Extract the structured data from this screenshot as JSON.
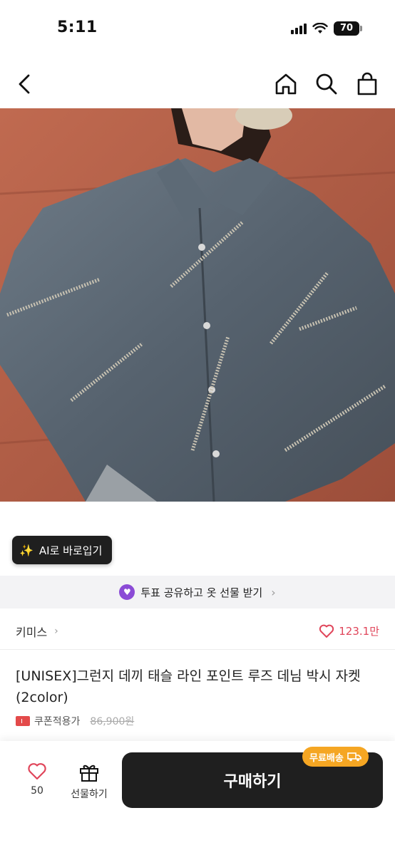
{
  "status": {
    "time": "5:11",
    "battery": "70"
  },
  "nav": {
    "back": "back",
    "home": "home",
    "search": "search",
    "bag": "shopping-bag"
  },
  "ai_button": {
    "label": "AI로 바로입기"
  },
  "share_banner": {
    "label": "투표 공유하고 옷 선물 받기"
  },
  "brand": {
    "name": "키미스",
    "likes": "123.1만"
  },
  "product": {
    "title": "[UNISEX]그런지 데끼 태슬 라인 포인트 루즈 데님 박시 자켓 (2color)",
    "coupon_label": "쿠폰적용가",
    "original_price": "86,900원"
  },
  "bottom": {
    "like_count": "50",
    "gift_label": "선물하기",
    "buy_label": "구매하기",
    "free_shipping": "무료배송"
  },
  "colors": {
    "accent_like": "#e0455a",
    "buy_button": "#1f1f1f",
    "free_ship": "#f5a623",
    "share_dot": "#8b4bd6"
  }
}
